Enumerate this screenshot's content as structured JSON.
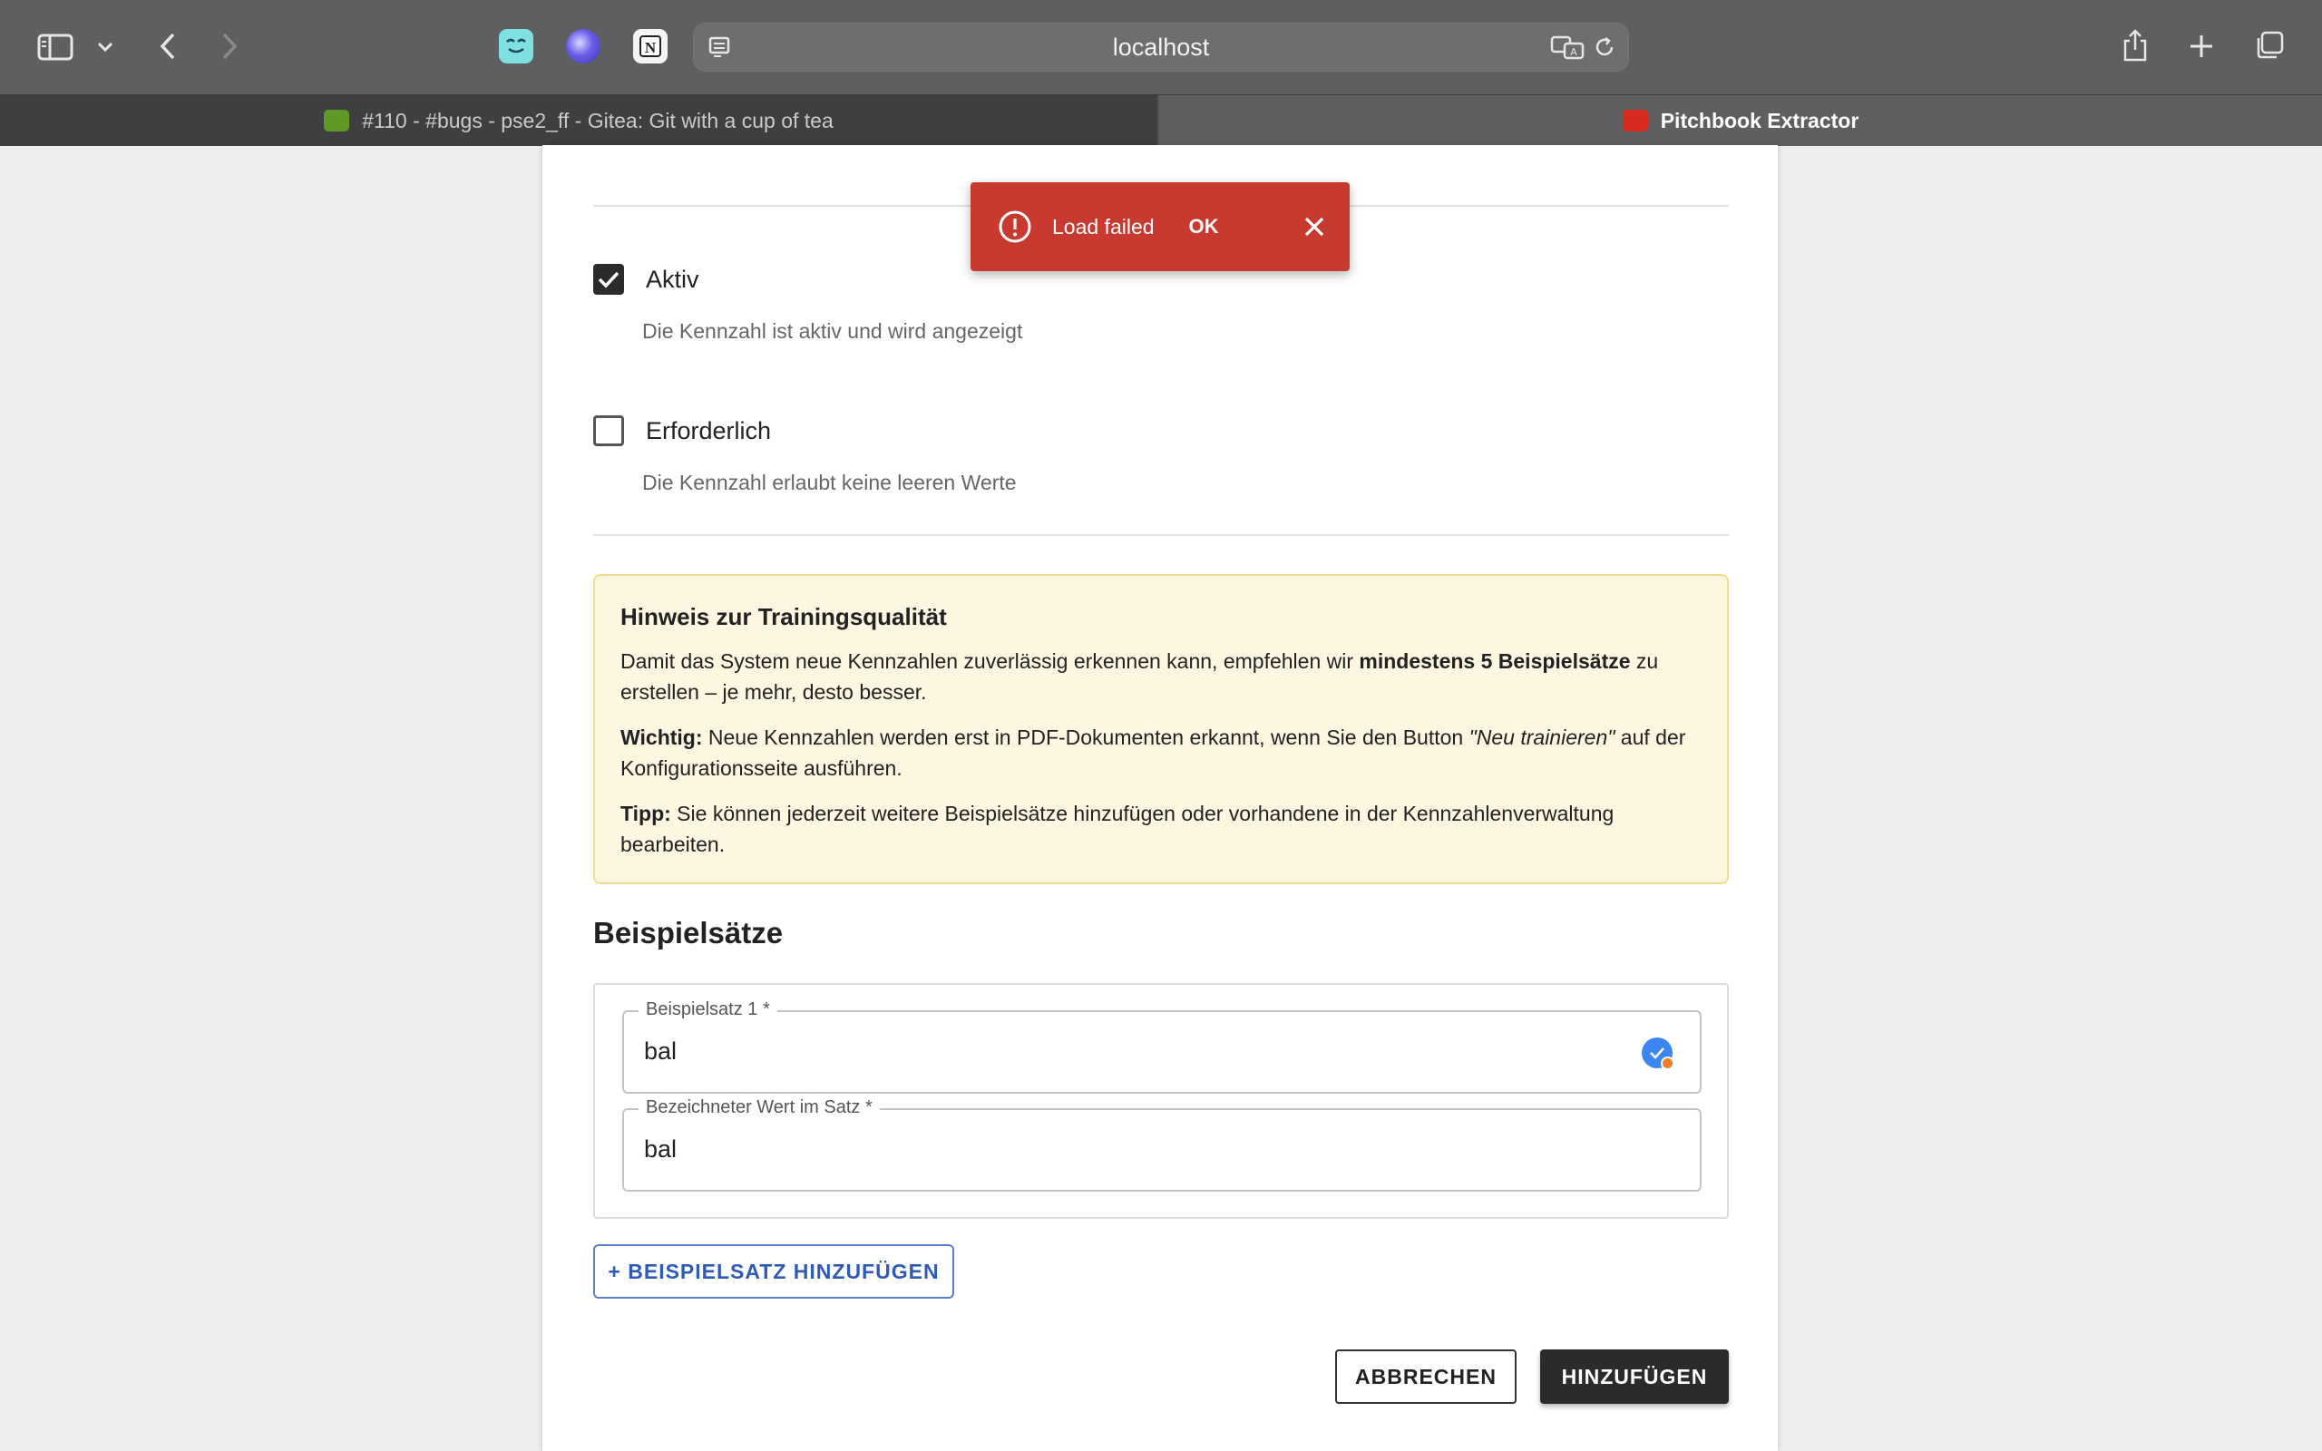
{
  "browser": {
    "url": "localhost",
    "tabs": [
      {
        "title": "#110 - #bugs - pse2_ff - Gitea: Git with a cup of tea",
        "active": false
      },
      {
        "title": "Pitchbook Extractor",
        "active": true
      }
    ]
  },
  "form": {
    "active": {
      "label": "Aktiv",
      "help": "Die Kennzahl ist aktiv und wird angezeigt",
      "checked": true
    },
    "required": {
      "label": "Erforderlich",
      "help": "Die Kennzahl erlaubt keine leeren Werte",
      "checked": false
    }
  },
  "hint": {
    "title": "Hinweis zur Trainingsqualität",
    "p1_pre": "Damit das System neue Kennzahlen zuverlässig erkennen kann, empfehlen wir ",
    "p1_bold": "mindestens 5 Beispielsätze",
    "p1_post": " zu erstellen – je mehr, desto besser.",
    "p2_bold": "Wichtig:",
    "p2_pre": " Neue Kennzahlen werden erst in PDF-Dokumenten erkannt, wenn Sie den Button ",
    "p2_italic": "\"Neu trainieren\"",
    "p2_post": " auf der Konfigurationsseite ausführen.",
    "p3_bold": "Tipp:",
    "p3_text": " Sie können jederzeit weitere Beispielsätze hinzufügen oder vorhandene in der Kennzahlenverwaltung bearbeiten."
  },
  "examples": {
    "title": "Beispielsätze",
    "sentence_label": "Beispielsatz 1 *",
    "sentence_value": "bal",
    "value_label": "Bezeichneter Wert im Satz *",
    "value_value": "bal",
    "add_label": "+ BEISPIELSATZ HINZUFÜGEN"
  },
  "actions": {
    "cancel": "ABBRECHEN",
    "submit": "HINZUFÜGEN"
  },
  "snackbar": {
    "message": "Load failed",
    "action": "OK",
    "color": "#c8392f"
  },
  "colors": {
    "accent": "#2f5bb5",
    "hint_bg": "#fdf6e1",
    "hint_border": "#f5dc8e",
    "primary_button": "#2b2b2b"
  }
}
